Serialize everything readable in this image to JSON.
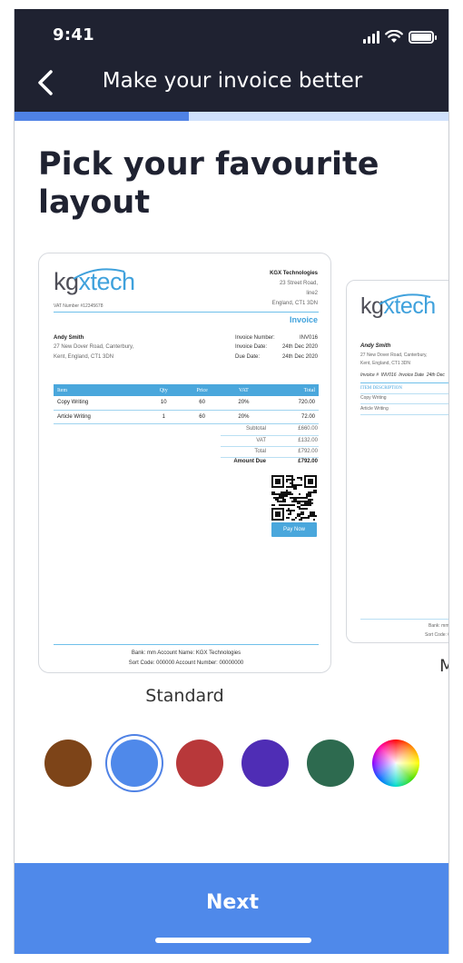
{
  "status_bar": {
    "time": "9:41"
  },
  "nav": {
    "title": "Make your invoice better"
  },
  "progress": {
    "fraction": 0.4
  },
  "page": {
    "title": "Pick your favourite layout"
  },
  "layouts": [
    {
      "label": "Standard",
      "selected": true,
      "logo": {
        "part1": "kg",
        "part2": "x",
        "part3": "tech"
      },
      "vat_number": "VAT Number #12345678",
      "company": {
        "name": "KGX Technologies",
        "address1": "23 Street Road,",
        "address2": "line2",
        "address3": "England, CT1 3DN"
      },
      "doc_title": "Invoice",
      "client": {
        "name": "Andy Smith",
        "address1": "27 New Dover Road, Canterbury,",
        "address2": "Kent, England, CT1 3DN"
      },
      "meta": [
        {
          "label": "Invoice Number:",
          "value": "INV016"
        },
        {
          "label": "Invoice Date:",
          "value": "24th Dec 2020"
        },
        {
          "label": "Due Date:",
          "value": "24th Dec 2020"
        }
      ],
      "columns": [
        "Item",
        "Qty",
        "Price",
        "VAT",
        "Total"
      ],
      "rows": [
        [
          "Copy Writing",
          "10",
          "60",
          "20%",
          "720.00"
        ],
        [
          "Article Writing",
          "1",
          "60",
          "20%",
          "72.00"
        ]
      ],
      "totals": [
        {
          "label": "Subtotal",
          "value": "£660.00"
        },
        {
          "label": "VAT",
          "value": "£132.00"
        },
        {
          "label": "Total",
          "value": "£792.00"
        },
        {
          "label": "Amount Due",
          "value": "£792.00"
        }
      ],
      "pay_button": "Pay Now",
      "footer_line1": "Bank: mm  Account Name: KGX Technologies",
      "footer_line2": "Sort Code: 000000  Account Number: 00000000"
    },
    {
      "label_partial": "M",
      "selected": false,
      "logo": {
        "part1": "kg",
        "part2": "x",
        "part3": "tech"
      },
      "client": {
        "name": "Andy Smith",
        "address1": "27 New Dover Road, Canterbury,",
        "address2": "Kent, England, CT1 3DN"
      },
      "invoice_line": {
        "label1": "Invoice #",
        "value1": "INV016",
        "label2": "Invoice Date",
        "value2": "24th Dec"
      },
      "column_header": "ITEM DESCRIPTION",
      "rows": [
        "Copy Writing",
        "Article Writing"
      ],
      "footer_line1": "Bank: mm",
      "footer_line2": "Sort Code: 0"
    }
  ],
  "colors": [
    {
      "name": "brown",
      "hex": "#7d4418",
      "selected": false
    },
    {
      "name": "blue",
      "hex": "#4f89ea",
      "selected": true
    },
    {
      "name": "red",
      "hex": "#b8383a",
      "selected": false
    },
    {
      "name": "purple",
      "hex": "#4f2db5",
      "selected": false
    },
    {
      "name": "green",
      "hex": "#2d6a4f",
      "selected": false
    },
    {
      "name": "custom",
      "hex": "multicolor",
      "selected": false
    }
  ],
  "accent": "#4f89ea",
  "header_bg": "#1f2231",
  "footer": {
    "next_label": "Next"
  }
}
